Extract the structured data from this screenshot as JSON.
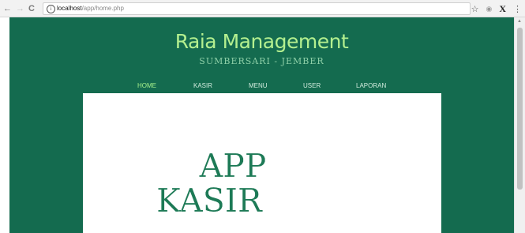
{
  "browser": {
    "back_icon": "←",
    "forward_icon": "→",
    "reload_icon": "C",
    "info_icon": "i",
    "url_host": "localhost",
    "url_path": "/app/home.php",
    "star_icon": "☆",
    "extension_icon": "◉",
    "extension_x": "X",
    "menu_icon": "⋮"
  },
  "site": {
    "title": "Raia Management",
    "subtitle": "SUMBERSARI - JEMBER"
  },
  "menu": {
    "items": [
      {
        "label": "HOME",
        "active": true
      },
      {
        "label": "KASIR",
        "active": false
      },
      {
        "label": "MENU",
        "active": false
      },
      {
        "label": "USER",
        "active": false
      },
      {
        "label": "LAPORAN",
        "active": false
      }
    ]
  },
  "hero": {
    "line1": "APP",
    "line2": "KASIR"
  },
  "colors": {
    "page_background": "#146b4f",
    "title_color": "#b3ef8f",
    "active_menu_color": "#a6f28c",
    "hero_text_color": "#1d7a56"
  }
}
